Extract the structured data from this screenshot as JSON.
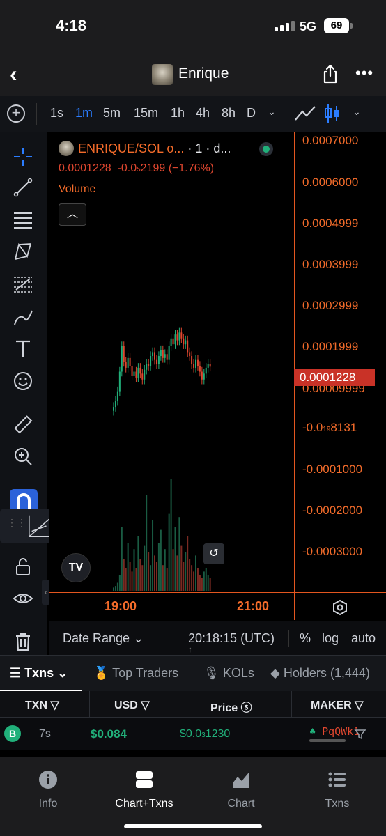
{
  "status_bar": {
    "time": "4:18",
    "network": "5G",
    "battery": "69"
  },
  "header": {
    "title": "Enrique",
    "back": "‹",
    "more": "•••"
  },
  "toolbar": {
    "timeframes": [
      "1s",
      "1m",
      "5m",
      "15m",
      "1h",
      "4h",
      "8h",
      "D"
    ],
    "active_timeframe": "1m"
  },
  "legend": {
    "symbol": "ENRIQUE/SOL o...",
    "interval": "· 1 · d...",
    "ohlc_close": "0.0001228",
    "change_prefix": "-0.0",
    "change_sub": "5",
    "change_suffix": "2199 (−1.76%)",
    "volume_label": "Volume"
  },
  "price_axis": {
    "ticks": [
      "0.0007000",
      "0.0006000",
      "0.0004999",
      "0.0003999",
      "0.0002999",
      "0.0001999",
      "0.00009999"
    ],
    "tick_neg_small_prefix": "-0.0",
    "tick_neg_small_sub": "19",
    "tick_neg_small_suffix": "8131",
    "neg_ticks": [
      "-0.0001000",
      "-0.0002000",
      "-0.0003000"
    ],
    "current_price": "0.0001228"
  },
  "time_axis": {
    "ticks": [
      "19:00",
      "21:00"
    ]
  },
  "chart_bar": {
    "date_range": "Date Range",
    "utc_time": "20:18:15 (UTC)",
    "pct": "%",
    "log": "log",
    "auto": "auto"
  },
  "tabs": [
    {
      "label": "Txns",
      "active": true
    },
    {
      "label": "Top Traders"
    },
    {
      "label": "KOLs"
    },
    {
      "label": "Holders (1,444)"
    }
  ],
  "table": {
    "headers": [
      "TXN",
      "USD",
      "Price",
      "MAKER"
    ],
    "rows": [
      {
        "type": "B",
        "age": "7s",
        "usd": "$0.084",
        "price_prefix": "$0.0",
        "price_sub": "3",
        "price_suffix": "1230",
        "maker": "PqQWk1"
      }
    ]
  },
  "bottom_nav": [
    {
      "label": "Info"
    },
    {
      "label": "Chart+Txns",
      "active": true
    },
    {
      "label": "Chart"
    },
    {
      "label": "Txns"
    }
  ],
  "colors": {
    "accent_orange": "#f26b2a",
    "up_green": "#21b07a",
    "down_red": "#e0472f",
    "active_blue": "#2b7dff"
  },
  "chart_data": {
    "type": "candlestick",
    "x_axis_ticks": [
      "19:00",
      "21:00"
    ],
    "y_axis_ticks": [
      0.0007,
      0.0006,
      0.0004999,
      0.0003999,
      0.0002999,
      0.0001999,
      9.999e-05,
      -0.0001,
      -0.0002,
      -0.0003
    ],
    "ylim": [
      -0.00035,
      0.0007
    ],
    "last_close": 0.0001228,
    "candles_close": [
      2e-05,
      3.5e-05,
      6e-05,
      0.00011,
      0.000175,
      0.000135,
      0.00012,
      0.000145,
      0.000125,
      0.0001,
      0.00011,
      9.5e-05,
      0.00012,
      0.000105,
      9e-05,
      0.000115,
      0.00013,
      0.000125,
      0.00015,
      0.00016,
      0.00014,
      0.00013,
      0.00015,
      0.000165,
      0.000145,
      0.000155,
      0.00014,
      0.000175,
      0.000195,
      0.00018,
      0.000205,
      0.00019,
      0.00021,
      0.000195,
      0.00018,
      0.00019,
      0.00016,
      0.00015,
      0.00013,
      0.00012,
      0.00014,
      0.000125,
      0.00011,
      9e-05,
      0.000105,
      0.00012,
      0.00013,
      0.0001228
    ],
    "volume": [
      2,
      3,
      5,
      10,
      40,
      20,
      14,
      30,
      18,
      12,
      26,
      14,
      34,
      20,
      16,
      28,
      60,
      24,
      16,
      44,
      22,
      18,
      30,
      38,
      16,
      26,
      14,
      48,
      70,
      26,
      40,
      22,
      46,
      28,
      18,
      24,
      34,
      20,
      16,
      12,
      22,
      14,
      10,
      8,
      12,
      14,
      10,
      8
    ]
  }
}
